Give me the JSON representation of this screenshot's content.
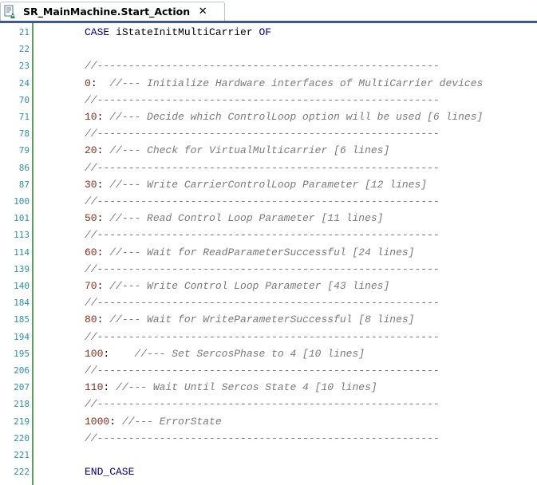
{
  "tab": {
    "title": "SR_MainMachine.Start_Action",
    "close_glyph": "✕"
  },
  "editor": {
    "lines": [
      {
        "ln": "21",
        "parts": [
          {
            "t": "CASE ",
            "c": "kw"
          },
          {
            "t": "iStateInitMultiCarrier ",
            "c": "id"
          },
          {
            "t": "OF",
            "c": "kw"
          }
        ]
      },
      {
        "ln": "22",
        "parts": []
      },
      {
        "ln": "23",
        "parts": [
          {
            "t": "//-------------------------------------------------------",
            "c": "cm"
          }
        ]
      },
      {
        "ln": "24",
        "parts": [
          {
            "t": "0",
            "c": "num"
          },
          {
            "t": ":  ",
            "c": "id"
          },
          {
            "t": "//--- Initialize Hardware interfaces of MultiCarrier devices",
            "c": "cm"
          }
        ]
      },
      {
        "ln": "70",
        "parts": [
          {
            "t": "//-------------------------------------------------------",
            "c": "cm"
          }
        ]
      },
      {
        "ln": "71",
        "parts": [
          {
            "t": "10",
            "c": "num"
          },
          {
            "t": ": ",
            "c": "id"
          },
          {
            "t": "//--- Decide which ControlLoop option will be used [6 lines]",
            "c": "cm"
          }
        ]
      },
      {
        "ln": "78",
        "parts": [
          {
            "t": "//-------------------------------------------------------",
            "c": "cm"
          }
        ]
      },
      {
        "ln": "79",
        "parts": [
          {
            "t": "20",
            "c": "num"
          },
          {
            "t": ": ",
            "c": "id"
          },
          {
            "t": "//--- Check for VirtualMulticarrier [6 lines]",
            "c": "cm"
          }
        ]
      },
      {
        "ln": "86",
        "parts": [
          {
            "t": "//-------------------------------------------------------",
            "c": "cm"
          }
        ]
      },
      {
        "ln": "87",
        "parts": [
          {
            "t": "30",
            "c": "num"
          },
          {
            "t": ": ",
            "c": "id"
          },
          {
            "t": "//--- Write CarrierControlLoop Parameter [12 lines]",
            "c": "cm"
          }
        ]
      },
      {
        "ln": "100",
        "parts": [
          {
            "t": "//-------------------------------------------------------",
            "c": "cm"
          }
        ]
      },
      {
        "ln": "101",
        "parts": [
          {
            "t": "50",
            "c": "num"
          },
          {
            "t": ": ",
            "c": "id"
          },
          {
            "t": "//--- Read Control Loop Parameter [11 lines]",
            "c": "cm"
          }
        ]
      },
      {
        "ln": "113",
        "parts": [
          {
            "t": "//-------------------------------------------------------",
            "c": "cm"
          }
        ]
      },
      {
        "ln": "114",
        "parts": [
          {
            "t": "60",
            "c": "num"
          },
          {
            "t": ": ",
            "c": "id"
          },
          {
            "t": "//--- Wait for ReadParameterSuccessful [24 lines]",
            "c": "cm"
          }
        ]
      },
      {
        "ln": "139",
        "parts": [
          {
            "t": "//-------------------------------------------------------",
            "c": "cm"
          }
        ]
      },
      {
        "ln": "140",
        "parts": [
          {
            "t": "70",
            "c": "num"
          },
          {
            "t": ": ",
            "c": "id"
          },
          {
            "t": "//--- Write Control Loop Parameter [43 lines]",
            "c": "cm"
          }
        ]
      },
      {
        "ln": "184",
        "parts": [
          {
            "t": "//-------------------------------------------------------",
            "c": "cm"
          }
        ]
      },
      {
        "ln": "185",
        "parts": [
          {
            "t": "80",
            "c": "num"
          },
          {
            "t": ": ",
            "c": "id"
          },
          {
            "t": "//--- Wait for WriteParameterSuccessful [8 lines]",
            "c": "cm"
          }
        ]
      },
      {
        "ln": "194",
        "parts": [
          {
            "t": "//-------------------------------------------------------",
            "c": "cm"
          }
        ]
      },
      {
        "ln": "195",
        "parts": [
          {
            "t": "100",
            "c": "num"
          },
          {
            "t": ":    ",
            "c": "id"
          },
          {
            "t": "//--- Set SercosPhase to 4 [10 lines]",
            "c": "cm"
          }
        ]
      },
      {
        "ln": "206",
        "parts": [
          {
            "t": "//-------------------------------------------------------",
            "c": "cm"
          }
        ]
      },
      {
        "ln": "207",
        "parts": [
          {
            "t": "110",
            "c": "num"
          },
          {
            "t": ": ",
            "c": "id"
          },
          {
            "t": "//--- Wait Until Sercos State 4 [10 lines]",
            "c": "cm"
          }
        ]
      },
      {
        "ln": "218",
        "parts": [
          {
            "t": "//-------------------------------------------------------",
            "c": "cm"
          }
        ]
      },
      {
        "ln": "219",
        "parts": [
          {
            "t": "1000",
            "c": "num"
          },
          {
            "t": ": ",
            "c": "id"
          },
          {
            "t": "//--- ErrorState",
            "c": "cm"
          }
        ]
      },
      {
        "ln": "220",
        "parts": [
          {
            "t": "//-------------------------------------------------------",
            "c": "cm"
          }
        ]
      },
      {
        "ln": "221",
        "parts": []
      },
      {
        "ln": "222",
        "parts": [
          {
            "t": "END_CASE",
            "c": "kw"
          }
        ]
      }
    ]
  }
}
